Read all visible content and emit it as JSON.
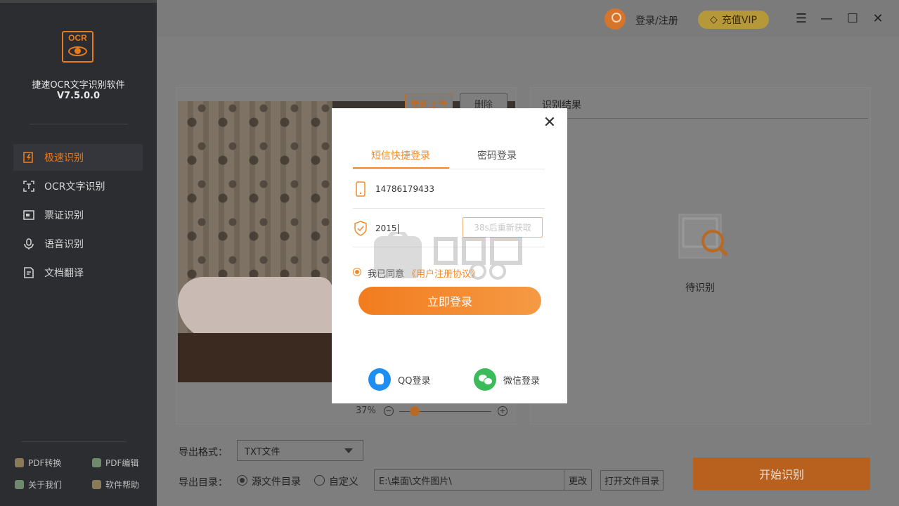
{
  "app": {
    "name": "捷速OCR文字识别软件",
    "version": "V7.5.0.0",
    "logo_text": "OCR"
  },
  "sidebar": {
    "items": [
      {
        "label": "极速识别",
        "icon": "lightning-doc-icon",
        "active": true
      },
      {
        "label": "OCR文字识别",
        "icon": "scan-frame-icon",
        "active": false
      },
      {
        "label": "票证识别",
        "icon": "card-icon",
        "active": false
      },
      {
        "label": "语音识别",
        "icon": "microphone-icon",
        "active": false
      },
      {
        "label": "文档翻译",
        "icon": "translate-doc-icon",
        "active": false
      }
    ],
    "bottom_links": [
      {
        "label": "PDF转换",
        "icon": "pdf-convert-icon"
      },
      {
        "label": "PDF编辑",
        "icon": "pdf-edit-icon"
      },
      {
        "label": "关于我们",
        "icon": "about-icon"
      },
      {
        "label": "软件帮助",
        "icon": "help-icon"
      }
    ]
  },
  "topbar": {
    "login_label": "登录/注册",
    "vip_label": "充值VIP",
    "menu_icon": "☰",
    "min_icon": "—",
    "max_icon": "☐",
    "close_icon": "✕"
  },
  "image_panel": {
    "reupload_label": "重新上传",
    "delete_label": "删除",
    "zoom": "37%",
    "zoom_value": 0.15
  },
  "result_panel": {
    "title": "识别结果",
    "pending": "待识别"
  },
  "export": {
    "format_label": "导出格式：",
    "format_value": "TXT文件",
    "dir_label": "导出目录：",
    "radio_source": "源文件目录",
    "radio_custom": "自定义",
    "selected": "source",
    "path_value": "E:\\桌面\\文件图片\\",
    "change_label": "更改",
    "open_dir_label": "打开文件目录",
    "start_label": "开始识别"
  },
  "login_modal": {
    "close": "✕",
    "tab_sms": "短信快捷登录",
    "tab_password": "密码登录",
    "phone": "14786179433",
    "code": "2015",
    "resend": "38s后重新获取",
    "agree_prefix": "我已同意",
    "agree_link": "《用户注册协议》",
    "login_button": "立即登录",
    "qq_login": "QQ登录",
    "wechat_login": "微信登录"
  },
  "colors": {
    "accent": "#f08b2c",
    "sidebar_bg": "#2b2d31",
    "start_button": "#b8601e"
  }
}
